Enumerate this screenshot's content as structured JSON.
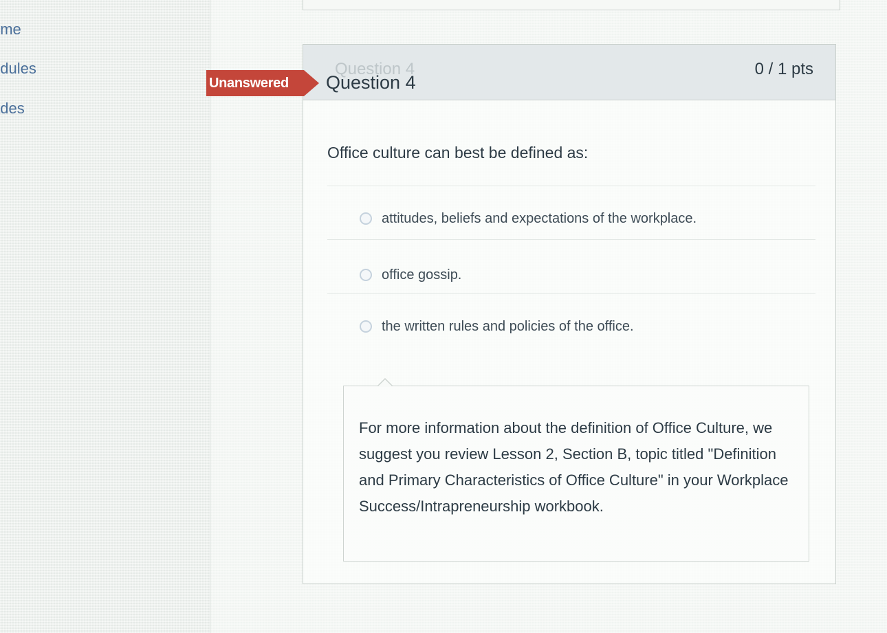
{
  "nav": {
    "items": [
      {
        "label": "ome"
      },
      {
        "label": "odules"
      },
      {
        "label": "ades"
      }
    ]
  },
  "question": {
    "status_badge": "Unanswered",
    "ghost_title": "Question 4",
    "title": "Question 4",
    "points": "0 / 1 pts",
    "text": "Office culture can best be defined as:",
    "answers": [
      {
        "label": "attitudes, beliefs and expectations of the workplace."
      },
      {
        "label": "office gossip."
      },
      {
        "label": "the written rules and policies of the office."
      }
    ],
    "feedback": "For more information about the definition of Office Culture, we suggest you review Lesson 2, Section B, topic titled \"Definition and Primary Characteristics of Office Culture\" in your Workplace Success/Intrapreneurship workbook."
  },
  "colors": {
    "badge": "#c4463a",
    "header_bg": "#e3e8ea",
    "nav_link": "#4a6f9a",
    "text": "#2d3b45"
  }
}
